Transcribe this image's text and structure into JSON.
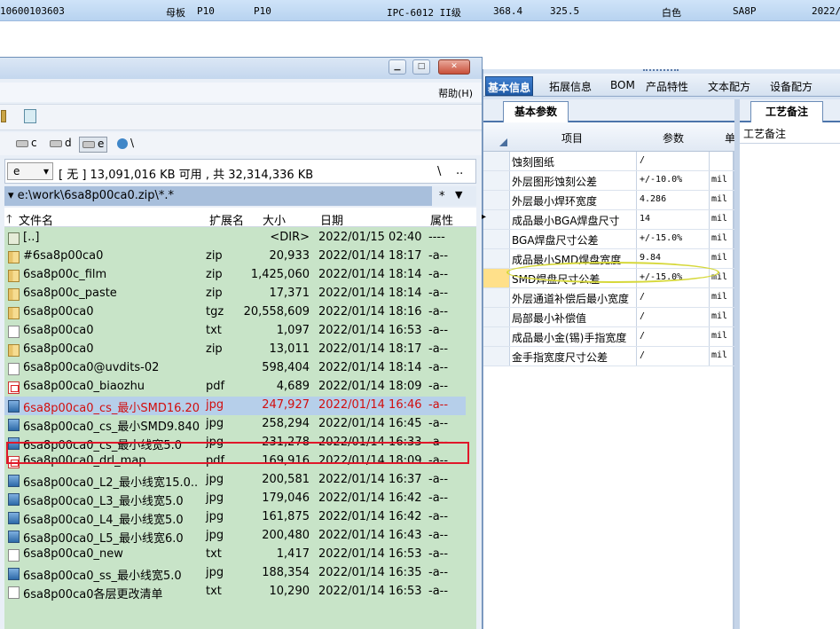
{
  "background_row": {
    "cells": [
      "10600103603",
      "母板",
      "P10",
      "P10",
      "IPC-6012 II级",
      "368.4",
      "325.5",
      "白色",
      "SA8P",
      "2022/"
    ]
  },
  "file_manager": {
    "window_buttons": {
      "minimize": "▁",
      "maximize": "□",
      "close": "✕"
    },
    "menu_help": "帮助(H)",
    "drives": [
      "c",
      "d",
      "e",
      "\\"
    ],
    "current_drive": "e",
    "free_space": "[ 无 ]  13,091,016 KB 可用 , 共 32,314,336 KB",
    "path_row1_right": [
      "\\",
      ".."
    ],
    "path": "e:\\work\\6sa8p00ca0.zip\\*.*",
    "path_row2_right": [
      "*",
      "▼"
    ],
    "columns": {
      "name": "文件名",
      "ext": "扩展名",
      "size": "大小",
      "date": "日期",
      "attr": "属性"
    },
    "files": [
      {
        "icon": "up",
        "name": "[..]",
        "ext": "",
        "size": "<DIR>",
        "date": "2022/01/15 02:40",
        "attr": "----"
      },
      {
        "icon": "zip",
        "name": "#6sa8p00ca0",
        "ext": "zip",
        "size": "20,933",
        "date": "2022/01/14 18:17",
        "attr": "-a--"
      },
      {
        "icon": "zip",
        "name": "6sa8p00c_film",
        "ext": "zip",
        "size": "1,425,060",
        "date": "2022/01/14 18:14",
        "attr": "-a--"
      },
      {
        "icon": "zip",
        "name": "6sa8p00c_paste",
        "ext": "zip",
        "size": "17,371",
        "date": "2022/01/14 18:14",
        "attr": "-a--"
      },
      {
        "icon": "tgz",
        "name": "6sa8p00ca0",
        "ext": "tgz",
        "size": "20,558,609",
        "date": "2022/01/14 18:16",
        "attr": "-a--"
      },
      {
        "icon": "txt",
        "name": "6sa8p00ca0",
        "ext": "txt",
        "size": "1,097",
        "date": "2022/01/14 16:53",
        "attr": "-a--"
      },
      {
        "icon": "zip",
        "name": "6sa8p00ca0",
        "ext": "zip",
        "size": "13,011",
        "date": "2022/01/14 18:17",
        "attr": "-a--"
      },
      {
        "icon": "txt",
        "name": "6sa8p00ca0@uvdits-02",
        "ext": "",
        "size": "598,404",
        "date": "2022/01/14 18:14",
        "attr": "-a--"
      },
      {
        "icon": "pdf",
        "name": "6sa8p00ca0_biaozhu",
        "ext": "pdf",
        "size": "4,689",
        "date": "2022/01/14 18:09",
        "attr": "-a--"
      },
      {
        "icon": "jpg",
        "name": "6sa8p00ca0_cs_最小SMD16.20",
        "ext": "jpg",
        "size": "247,927",
        "date": "2022/01/14 16:46",
        "attr": "-a--",
        "selected": true
      },
      {
        "icon": "jpg",
        "name": "6sa8p00ca0_cs_最小SMD9.840",
        "ext": "jpg",
        "size": "258,294",
        "date": "2022/01/14 16:45",
        "attr": "-a--"
      },
      {
        "icon": "jpg",
        "name": "6sa8p00ca0_cs_最小线宽5.0",
        "ext": "jpg",
        "size": "231,278",
        "date": "2022/01/14 16:33",
        "attr": "-a--"
      },
      {
        "icon": "pdf",
        "name": "6sa8p00ca0_drl_map",
        "ext": "pdf",
        "size": "169,916",
        "date": "2022/01/14 18:09",
        "attr": "-a--"
      },
      {
        "icon": "jpg",
        "name": "6sa8p00ca0_L2_最小线宽15.0..",
        "ext": "jpg",
        "size": "200,581",
        "date": "2022/01/14 16:37",
        "attr": "-a--"
      },
      {
        "icon": "jpg",
        "name": "6sa8p00ca0_L3_最小线宽5.0",
        "ext": "jpg",
        "size": "179,046",
        "date": "2022/01/14 16:42",
        "attr": "-a--"
      },
      {
        "icon": "jpg",
        "name": "6sa8p00ca0_L4_最小线宽5.0",
        "ext": "jpg",
        "size": "161,875",
        "date": "2022/01/14 16:42",
        "attr": "-a--"
      },
      {
        "icon": "jpg",
        "name": "6sa8p00ca0_L5_最小线宽6.0",
        "ext": "jpg",
        "size": "200,480",
        "date": "2022/01/14 16:43",
        "attr": "-a--"
      },
      {
        "icon": "txt",
        "name": "6sa8p00ca0_new",
        "ext": "txt",
        "size": "1,417",
        "date": "2022/01/14 16:53",
        "attr": "-a--"
      },
      {
        "icon": "jpg",
        "name": "6sa8p00ca0_ss_最小线宽5.0",
        "ext": "jpg",
        "size": "188,354",
        "date": "2022/01/14 16:35",
        "attr": "-a--"
      },
      {
        "icon": "txt",
        "name": "6sa8p00ca0各层更改清单",
        "ext": "txt",
        "size": "10,290",
        "date": "2022/01/14 16:53",
        "attr": "-a--"
      }
    ]
  },
  "app_panel": {
    "tabs": [
      "基本信息",
      "拓展信息",
      "BOM",
      "产品特性",
      "文本配方",
      "设备配方"
    ],
    "active_tab": "基本信息",
    "left_subtab": "基本参数",
    "right_subtab": "工艺备注",
    "right_label": "工艺备注",
    "grid_headers": {
      "item": "项目",
      "param": "参数",
      "unit": "单"
    },
    "rows": [
      {
        "item": "蚀刻图纸",
        "param": "/",
        "unit": ""
      },
      {
        "item": "外层图形蚀刻公差",
        "param": "+/-10.0%",
        "unit": "mil"
      },
      {
        "item": "外层最小焊环宽度",
        "param": "4.286",
        "unit": "mil"
      },
      {
        "item": "成品最小BGA焊盘尺寸",
        "param": "14",
        "unit": "mil",
        "current": true
      },
      {
        "item": "BGA焊盘尺寸公差",
        "param": "+/-15.0%",
        "unit": "mil"
      },
      {
        "item": "成品最小SMD焊盘宽度",
        "param": "9.84",
        "unit": "mil"
      },
      {
        "item": "SMD焊盘尺寸公差",
        "param": "+/-15.0%",
        "unit": "mil",
        "marked": true
      },
      {
        "item": "外层通道补偿后最小宽度",
        "param": "/",
        "unit": "mil"
      },
      {
        "item": "局部最小补偿值",
        "param": "/",
        "unit": "mil"
      },
      {
        "item": "成品最小金(锡)手指宽度",
        "param": "/",
        "unit": "mil"
      },
      {
        "item": "金手指宽度尺寸公差",
        "param": "/",
        "unit": "mil"
      }
    ]
  }
}
